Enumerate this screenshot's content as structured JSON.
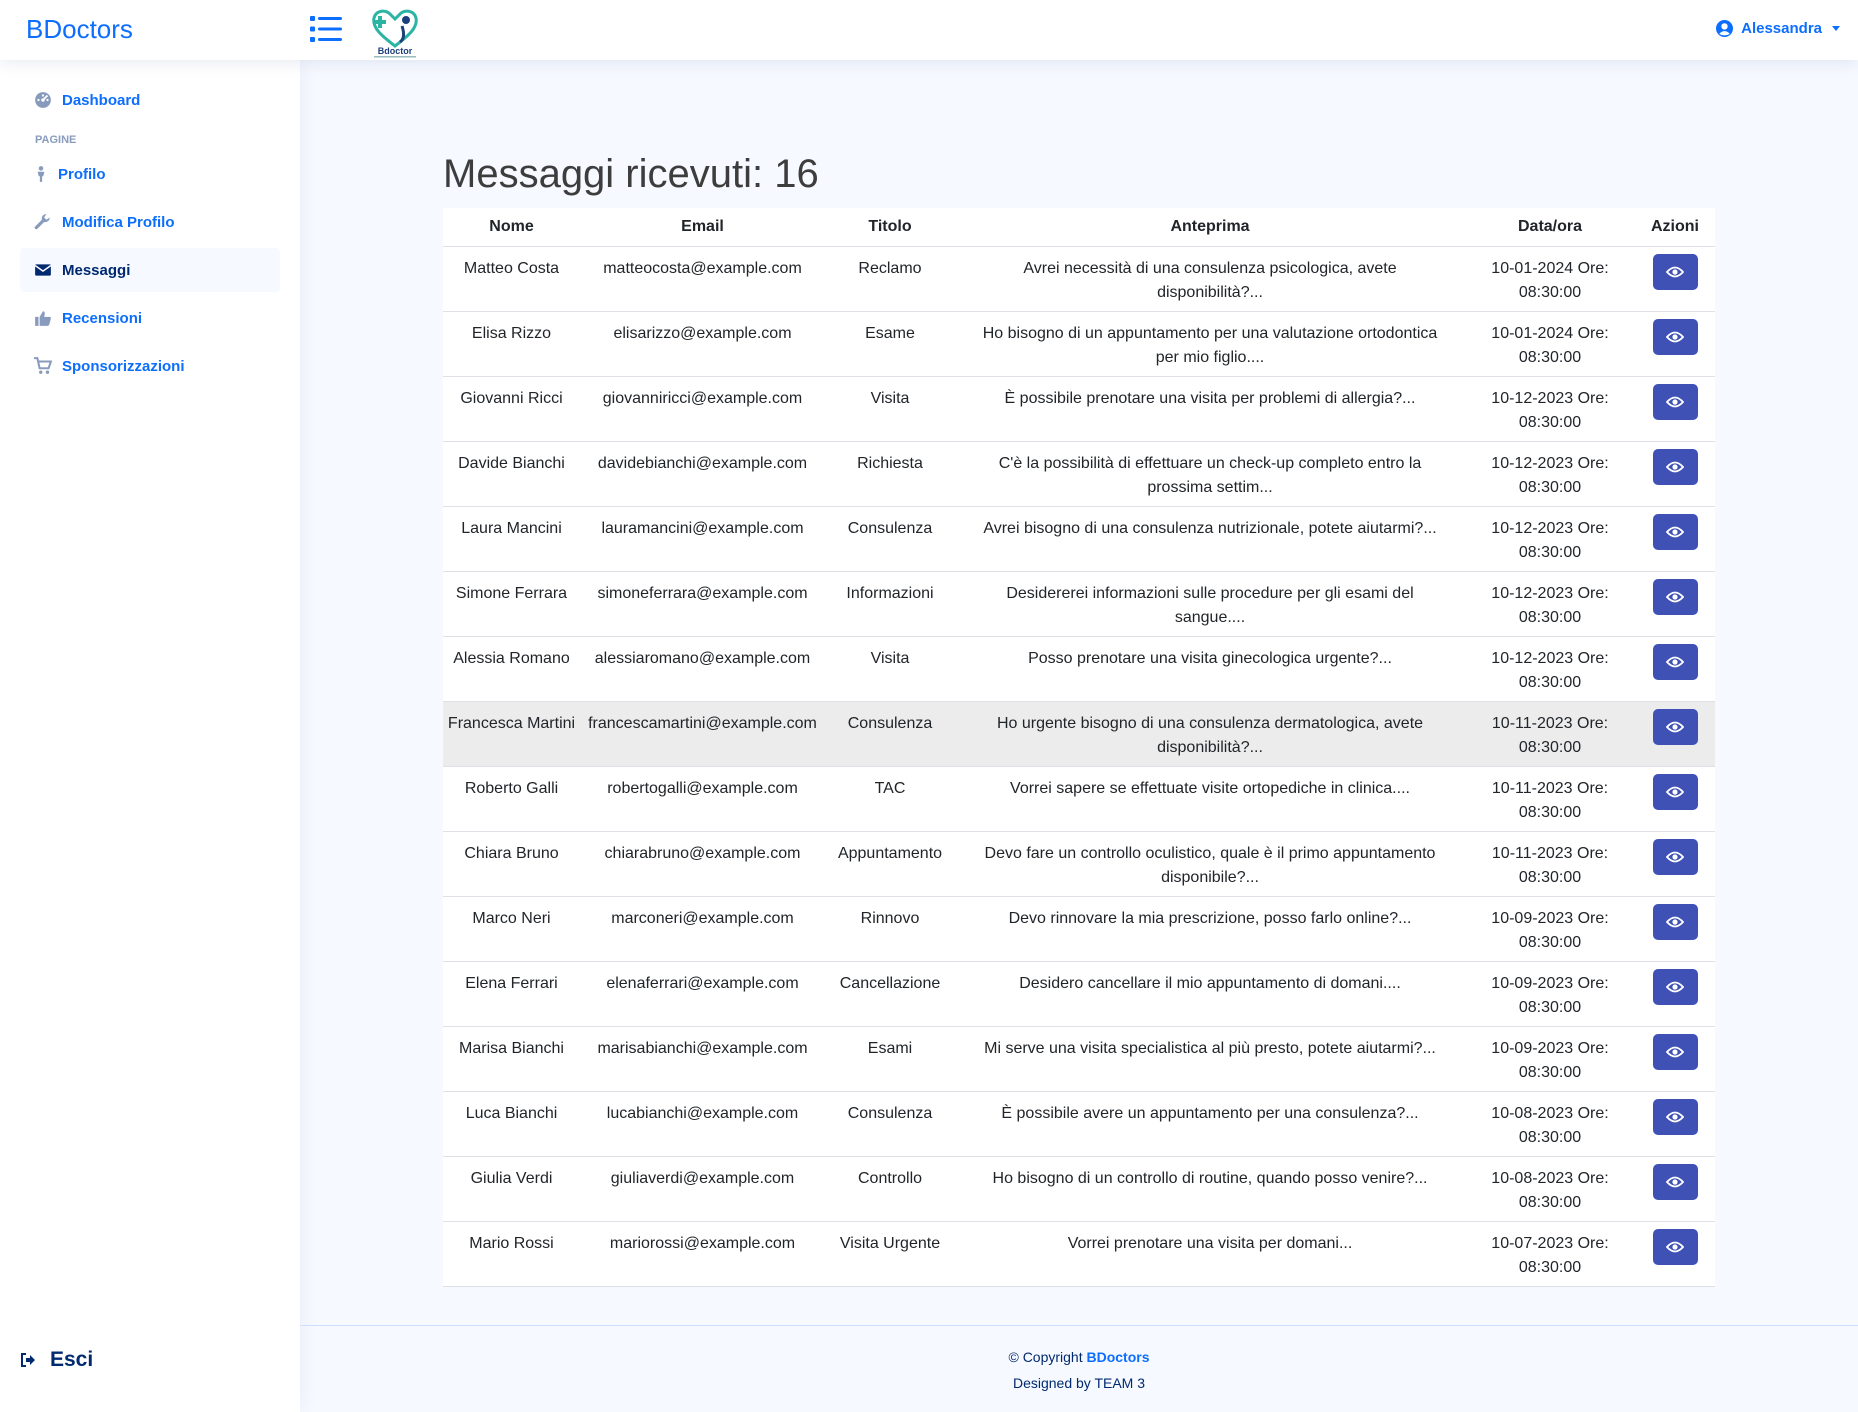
{
  "header": {
    "brand": "BDoctors",
    "logo_text": "Bdoctor",
    "user_name": "Alessandra"
  },
  "sidebar": {
    "items": [
      {
        "label": "Dashboard",
        "icon": "dashboard-icon"
      },
      {
        "label": "Profilo",
        "icon": "person-icon"
      },
      {
        "label": "Modifica Profilo",
        "icon": "wrench-icon"
      },
      {
        "label": "Messaggi",
        "icon": "envelope-icon",
        "active": true
      },
      {
        "label": "Recensioni",
        "icon": "thumbs-up-icon"
      },
      {
        "label": "Sponsorizzazioni",
        "icon": "cart-icon"
      }
    ],
    "heading": "PAGINE",
    "logout_label": "Esci"
  },
  "main": {
    "title": "Messaggi ricevuti: 16",
    "columns": [
      "Nome",
      "Email",
      "Titolo",
      "Anteprima",
      "Data/ora",
      "Azioni"
    ],
    "rows": [
      {
        "nome": "Matteo Costa",
        "email": "matteocosta@example.com",
        "titolo": "Reclamo",
        "anteprima": "Avrei necessità di una consulenza psicologica, avete disponibilità?...",
        "data": "10-01-2024 Ore:",
        "ora": "08:30:00"
      },
      {
        "nome": "Elisa Rizzo",
        "email": "elisarizzo@example.com",
        "titolo": "Esame",
        "anteprima": "Ho bisogno di un appuntamento per una valutazione ortodontica per mio figlio....",
        "data": "10-01-2024 Ore:",
        "ora": "08:30:00"
      },
      {
        "nome": "Giovanni Ricci",
        "email": "giovanniricci@example.com",
        "titolo": "Visita",
        "anteprima": "È possibile prenotare una visita per problemi di allergia?...",
        "data": "10-12-2023 Ore:",
        "ora": "08:30:00"
      },
      {
        "nome": "Davide Bianchi",
        "email": "davidebianchi@example.com",
        "titolo": "Richiesta",
        "anteprima": "C'è la possibilità di effettuare un check-up completo entro la prossima settim...",
        "data": "10-12-2023 Ore:",
        "ora": "08:30:00"
      },
      {
        "nome": "Laura Mancini",
        "email": "lauramancini@example.com",
        "titolo": "Consulenza",
        "anteprima": "Avrei bisogno di una consulenza nutrizionale, potete aiutarmi?...",
        "data": "10-12-2023 Ore:",
        "ora": "08:30:00"
      },
      {
        "nome": "Simone Ferrara",
        "email": "simoneferrara@example.com",
        "titolo": "Informazioni",
        "anteprima": "Desidererei informazioni sulle procedure per gli esami del sangue....",
        "data": "10-12-2023 Ore:",
        "ora": "08:30:00"
      },
      {
        "nome": "Alessia Romano",
        "email": "alessiaromano@example.com",
        "titolo": "Visita",
        "anteprima": "Posso prenotare una visita ginecologica urgente?...",
        "data": "10-12-2023 Ore:",
        "ora": "08:30:00"
      },
      {
        "nome": "Francesca Martini",
        "email": "francescamartini@example.com",
        "titolo": "Consulenza",
        "anteprima": "Ho urgente bisogno di una consulenza dermatologica, avete disponibilità?...",
        "data": "10-11-2023 Ore:",
        "ora": "08:30:00"
      },
      {
        "nome": "Roberto Galli",
        "email": "robertogalli@example.com",
        "titolo": "TAC",
        "anteprima": "Vorrei sapere se effettuate visite ortopediche in clinica....",
        "data": "10-11-2023 Ore:",
        "ora": "08:30:00"
      },
      {
        "nome": "Chiara Bruno",
        "email": "chiarabruno@example.com",
        "titolo": "Appuntamento",
        "anteprima": "Devo fare un controllo oculistico, quale è il primo appuntamento disponibile?...",
        "data": "10-11-2023 Ore:",
        "ora": "08:30:00"
      },
      {
        "nome": "Marco Neri",
        "email": "marconeri@example.com",
        "titolo": "Rinnovo",
        "anteprima": "Devo rinnovare la mia prescrizione, posso farlo online?...",
        "data": "10-09-2023 Ore:",
        "ora": "08:30:00"
      },
      {
        "nome": "Elena Ferrari",
        "email": "elenaferrari@example.com",
        "titolo": "Cancellazione",
        "anteprima": "Desidero cancellare il mio appuntamento di domani....",
        "data": "10-09-2023 Ore:",
        "ora": "08:30:00"
      },
      {
        "nome": "Marisa Bianchi",
        "email": "marisabianchi@example.com",
        "titolo": "Esami",
        "anteprima": "Mi serve una visita specialistica al più presto, potete aiutarmi?...",
        "data": "10-09-2023 Ore:",
        "ora": "08:30:00"
      },
      {
        "nome": "Luca Bianchi",
        "email": "lucabianchi@example.com",
        "titolo": "Consulenza",
        "anteprima": "È possibile avere un appuntamento per una consulenza?...",
        "data": "10-08-2023 Ore:",
        "ora": "08:30:00"
      },
      {
        "nome": "Giulia Verdi",
        "email": "giuliaverdi@example.com",
        "titolo": "Controllo",
        "anteprima": "Ho bisogno di un controllo di routine, quando posso venire?...",
        "data": "10-08-2023 Ore:",
        "ora": "08:30:00"
      },
      {
        "nome": "Mario Rossi",
        "email": "mariorossi@example.com",
        "titolo": "Visita Urgente",
        "anteprima": "Vorrei prenotare una visita per domani...",
        "data": "10-07-2023 Ore:",
        "ora": "08:30:00"
      }
    ]
  },
  "footer": {
    "copyright_prefix": "© Copyright",
    "copyright_brand": "BDoctors",
    "designed_prefix": "Designed by",
    "designed_team": "TEAM 3"
  },
  "colors": {
    "brand": "#0d6efd",
    "button": "#3f51b5",
    "nav_active": "#012970"
  }
}
